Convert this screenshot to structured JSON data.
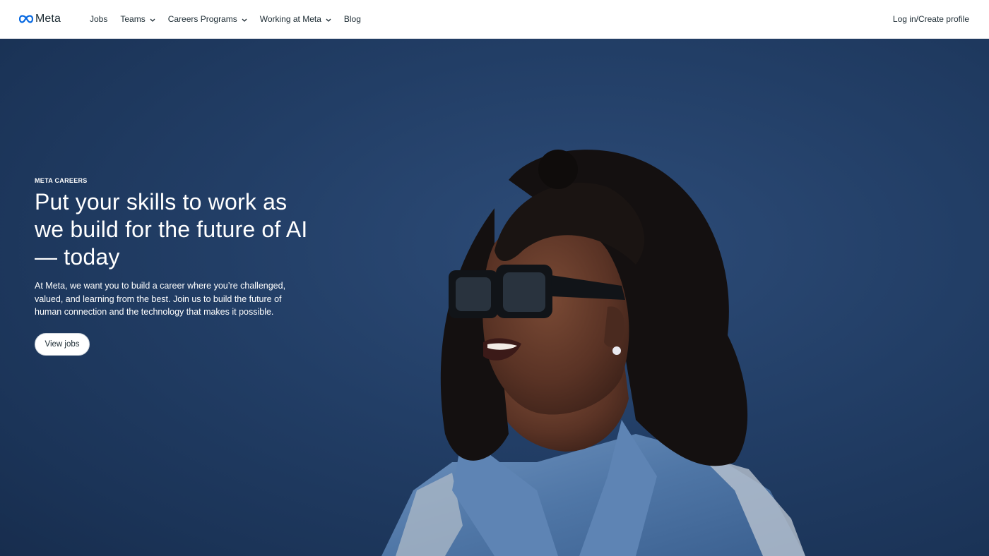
{
  "brand": {
    "name": "Meta",
    "logo_icon": "meta-infinity-icon",
    "logo_color": "#0668E1"
  },
  "nav": {
    "items": [
      {
        "label": "Jobs",
        "dropdown": false
      },
      {
        "label": "Teams",
        "dropdown": true
      },
      {
        "label": "Careers Programs",
        "dropdown": true
      },
      {
        "label": "Working at Meta",
        "dropdown": true
      },
      {
        "label": "Blog",
        "dropdown": false
      }
    ],
    "login_label": "Log in/Create profile"
  },
  "hero": {
    "eyebrow": "META CAREERS",
    "headline": "Put your skills to work as we build for the future of AI — today",
    "subtext": "At Meta, we want you to build a career where you’re challenged, valued, and learning from the best. Join us to build the future of human connection and the technology that makes it possible.",
    "cta_label": "View jobs",
    "background_color": "#223e66"
  }
}
